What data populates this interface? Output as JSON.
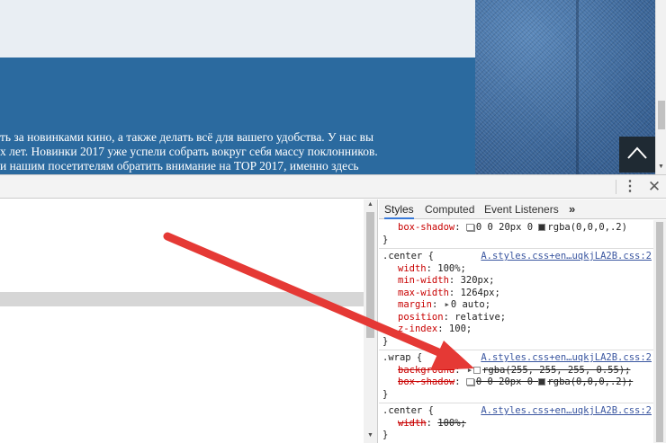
{
  "website": {
    "text_lines": [
      "ть за новинками кино, а также делать всё для вашего удобства. У нас вы",
      "х лет. Новинки 2017 уже успели собрать вокруг себя массу поклонников.",
      "и нашим посетителям обратить внимание на TOP 2017, именно здесь"
    ],
    "scroll_top_icon": "chevron-up-icon"
  },
  "devtools": {
    "menu_icon": "⋮",
    "close_icon": "✕",
    "styles_tabs": {
      "styles": "Styles",
      "computed": "Computed",
      "event_listeners": "Event Listeners",
      "more": "»"
    },
    "rules": [
      {
        "selector": "",
        "source": "",
        "props": [
          {
            "name": "box-shadow",
            "value": "0 0 20px 0 ",
            "color_value": "rgba(0,0,0,.2)",
            "swatch": "#333333",
            "icon": "shadow",
            "struck": false
          }
        ]
      },
      {
        "selector": ".center {",
        "source": "A.styles.css+en…uqkjLA2B.css:2",
        "props": [
          {
            "name": "width",
            "value": "100%;"
          },
          {
            "name": "min-width",
            "value": "320px;"
          },
          {
            "name": "max-width",
            "value": "1264px;"
          },
          {
            "name": "margin",
            "value": "0 auto;",
            "expand": true
          },
          {
            "name": "position",
            "value": "relative;"
          },
          {
            "name": "z-index",
            "value": "100;"
          }
        ]
      },
      {
        "selector": ".wrap {",
        "source": "A.styles.css+en…uqkjLA2B.css:2",
        "props": [
          {
            "name": "background",
            "value": "",
            "color_value": "rgba(255, 255, 255, 0.55);",
            "swatch": "#ffffff",
            "expand": true,
            "struck": true
          },
          {
            "name": "box-shadow",
            "value": "0 0 20px 0 ",
            "color_value": "rgba(0,0,0,.2);",
            "swatch": "#333333",
            "icon": "shadow",
            "struck": true
          }
        ]
      },
      {
        "selector": ".center {",
        "source": "A.styles.css+en…uqkjLA2B.css:2",
        "props": [
          {
            "name": "width",
            "value": "100%;",
            "struck": true
          }
        ]
      }
    ],
    "close_brace": "}"
  },
  "colors": {
    "site_band": "#2b6a9f",
    "property_name": "#c80000",
    "source_link": "#3a56a0",
    "annotation_arrow": "#e53935",
    "active_tab": "#3879d9"
  }
}
